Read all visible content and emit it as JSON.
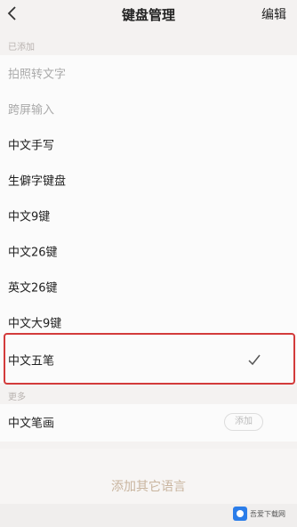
{
  "header": {
    "title": "键盘管理",
    "edit_label": "编辑"
  },
  "sections": {
    "added_label": "已添加",
    "more_label": "更多"
  },
  "added_items": [
    {
      "label": "拍照转文字",
      "disabled": true
    },
    {
      "label": "跨屏输入",
      "disabled": true
    },
    {
      "label": "中文手写",
      "disabled": false
    },
    {
      "label": "生僻字键盘",
      "disabled": false
    },
    {
      "label": "中文9键",
      "disabled": false
    },
    {
      "label": "中文26键",
      "disabled": false
    },
    {
      "label": "英文26键",
      "disabled": false
    },
    {
      "label": "中文大9键",
      "disabled": false
    },
    {
      "label": "中文五笔",
      "disabled": false,
      "selected": true
    }
  ],
  "more_items": [
    {
      "label": "中文笔画",
      "button": "添加"
    }
  ],
  "add_language_label": "添加其它语言",
  "watermark": {
    "text": "吾爱下载网"
  },
  "colors": {
    "highlight_border": "#d33b3b",
    "add_language_text": "#c9b59f"
  }
}
